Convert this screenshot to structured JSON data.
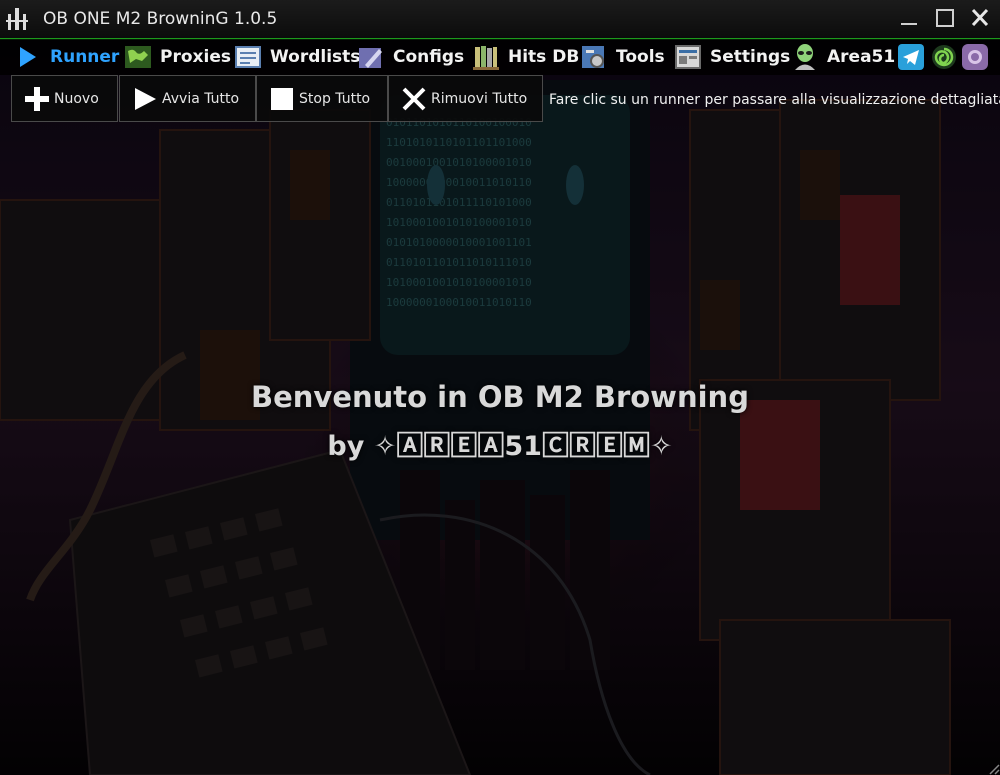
{
  "window": {
    "title": "OB ONE M2 BrowninG 1.0.5",
    "accent_color": "#1c9a1c",
    "controls": [
      "minimize",
      "maximize",
      "close"
    ]
  },
  "menu": {
    "items": [
      {
        "label": "Runner",
        "icon": "play-icon",
        "active": true
      },
      {
        "label": "Proxies",
        "icon": "world-map-icon",
        "active": false
      },
      {
        "label": "Wordlists",
        "icon": "document-icon",
        "active": false
      },
      {
        "label": "Configs",
        "icon": "edit-pen-icon",
        "active": false
      },
      {
        "label": "Hits DB",
        "icon": "books-icon",
        "active": false
      },
      {
        "label": "Tools",
        "icon": "tools-icon",
        "active": false
      },
      {
        "label": "Settings",
        "icon": "settings-panel-icon",
        "active": false
      },
      {
        "label": "Area51",
        "icon": "alien-icon",
        "active": false
      }
    ],
    "active_color": "#2fa3ff",
    "social_icons": [
      "telegram-icon",
      "spiral-icon",
      "camera-icon"
    ]
  },
  "toolbar": {
    "buttons": [
      {
        "label": "Nuovo",
        "icon": "plus-icon"
      },
      {
        "label": "Avvia Tutto",
        "icon": "play-outline-icon"
      },
      {
        "label": "Stop Tutto",
        "icon": "stop-icon"
      },
      {
        "label": "Rimuovi Tutto",
        "icon": "x-icon"
      }
    ],
    "hint": "Fare clic su un runner per passare alla visualizzazione dettagliata"
  },
  "welcome": {
    "line1": "Benvenuto in OB M2 Browning",
    "line2": "by ✧🄰🅁🄴🄰51🄲🅁🄴🄼✧"
  }
}
